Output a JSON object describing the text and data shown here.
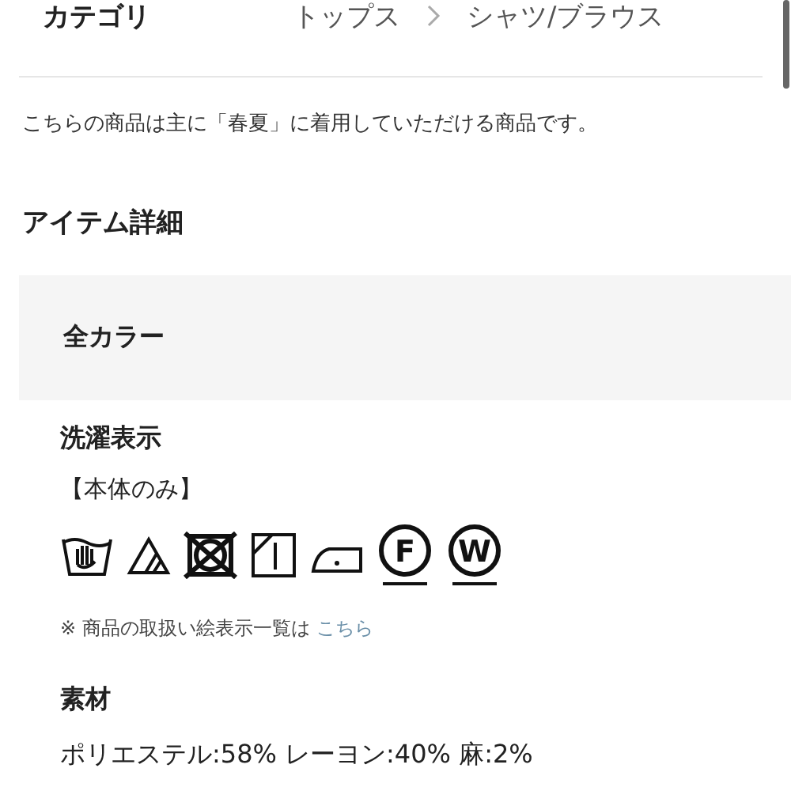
{
  "category": {
    "label": "カテゴリ",
    "path": [
      "トップス",
      "シャツ/ブラウス"
    ]
  },
  "season_note": "こちらの商品は主に「春夏」に着用していただける商品です。",
  "item_details": {
    "heading": "アイテム詳細",
    "color_group": {
      "title": "全カラー",
      "care": {
        "heading": "洗濯表示",
        "scope": "【本体のみ】",
        "symbols": [
          {
            "kind": "hand_wash"
          },
          {
            "kind": "oxygen_bleach"
          },
          {
            "kind": "no_tumble"
          },
          {
            "kind": "line_dry_shade"
          },
          {
            "kind": "iron_low"
          },
          {
            "kind": "circle_letter",
            "letter": "F"
          },
          {
            "kind": "circle_letter",
            "letter": "W"
          }
        ],
        "note": "※ 商品の取扱い絵表示一覧は",
        "link": "こちら"
      },
      "material": {
        "heading": "素材",
        "value": "ポリエステル:58% レーヨン:40% 麻:2%"
      }
    }
  }
}
